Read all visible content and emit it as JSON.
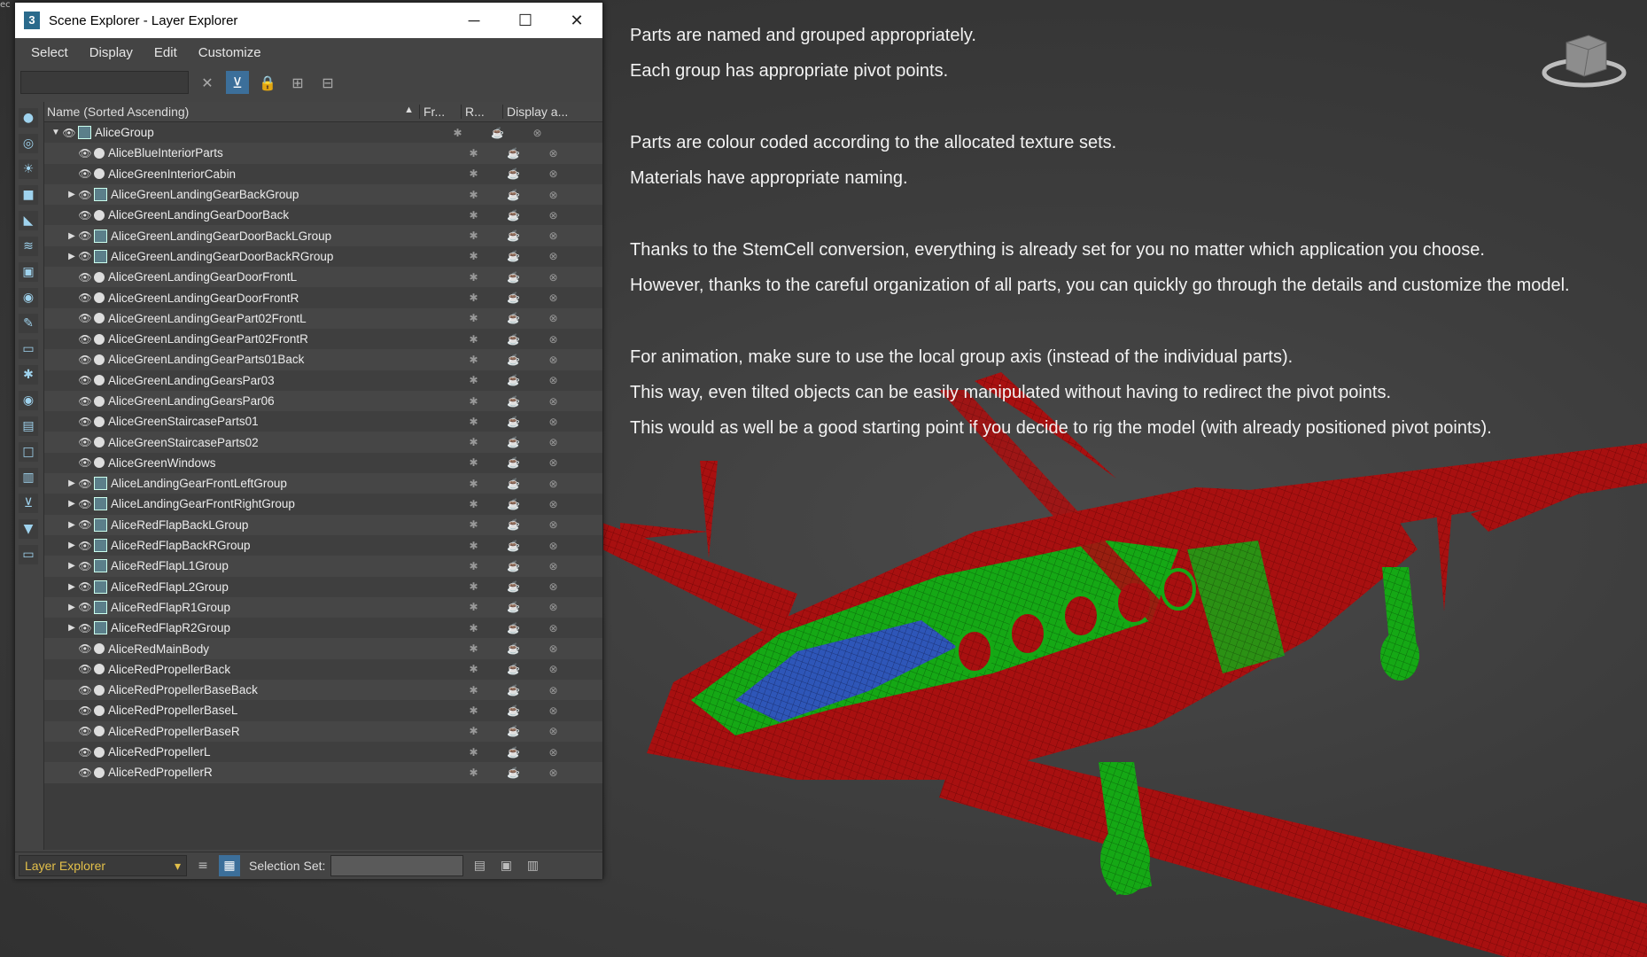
{
  "corner_text": "ec",
  "window": {
    "title": "Scene Explorer - Layer Explorer",
    "app_icon": "3",
    "buttons": {
      "minimize": "─",
      "maximize": "☐",
      "close": "✕"
    }
  },
  "menu": [
    "Select",
    "Display",
    "Edit",
    "Customize"
  ],
  "toolbar": {
    "clear": "✕",
    "filter": "⊻",
    "lock": "🔒",
    "hier1": "⊞",
    "hier2": "⊟"
  },
  "table": {
    "columns": {
      "name": "Name (Sorted Ascending)",
      "sort_arrow": "▲",
      "frozen": "Fr...",
      "render": "R...",
      "display": "Display a..."
    },
    "rows": [
      {
        "label": "AliceGroup",
        "indent": 0,
        "expander": "▼",
        "kind": "group"
      },
      {
        "label": "AliceBlueInteriorParts",
        "indent": 1,
        "expander": "",
        "kind": "object"
      },
      {
        "label": "AliceGreenInteriorCabin",
        "indent": 1,
        "expander": "",
        "kind": "object"
      },
      {
        "label": "AliceGreenLandingGearBackGroup",
        "indent": 1,
        "expander": "▶",
        "kind": "group"
      },
      {
        "label": "AliceGreenLandingGearDoorBack",
        "indent": 1,
        "expander": "",
        "kind": "object"
      },
      {
        "label": "AliceGreenLandingGearDoorBackLGroup",
        "indent": 1,
        "expander": "▶",
        "kind": "group"
      },
      {
        "label": "AliceGreenLandingGearDoorBackRGroup",
        "indent": 1,
        "expander": "▶",
        "kind": "group"
      },
      {
        "label": "AliceGreenLandingGearDoorFrontL",
        "indent": 1,
        "expander": "",
        "kind": "object"
      },
      {
        "label": "AliceGreenLandingGearDoorFrontR",
        "indent": 1,
        "expander": "",
        "kind": "object"
      },
      {
        "label": "AliceGreenLandingGearPart02FrontL",
        "indent": 1,
        "expander": "",
        "kind": "object"
      },
      {
        "label": "AliceGreenLandingGearPart02FrontR",
        "indent": 1,
        "expander": "",
        "kind": "object"
      },
      {
        "label": "AliceGreenLandingGearParts01Back",
        "indent": 1,
        "expander": "",
        "kind": "object"
      },
      {
        "label": "AliceGreenLandingGearsPar03",
        "indent": 1,
        "expander": "",
        "kind": "object"
      },
      {
        "label": "AliceGreenLandingGearsPar06",
        "indent": 1,
        "expander": "",
        "kind": "object"
      },
      {
        "label": "AliceGreenStaircaseParts01",
        "indent": 1,
        "expander": "",
        "kind": "object"
      },
      {
        "label": "AliceGreenStaircaseParts02",
        "indent": 1,
        "expander": "",
        "kind": "object"
      },
      {
        "label": "AliceGreenWindows",
        "indent": 1,
        "expander": "",
        "kind": "object"
      },
      {
        "label": "AliceLandingGearFrontLeftGroup",
        "indent": 1,
        "expander": "▶",
        "kind": "group"
      },
      {
        "label": "AliceLandingGearFrontRightGroup",
        "indent": 1,
        "expander": "▶",
        "kind": "group"
      },
      {
        "label": "AliceRedFlapBackLGroup",
        "indent": 1,
        "expander": "▶",
        "kind": "group"
      },
      {
        "label": "AliceRedFlapBackRGroup",
        "indent": 1,
        "expander": "▶",
        "kind": "group"
      },
      {
        "label": "AliceRedFlapL1Group",
        "indent": 1,
        "expander": "▶",
        "kind": "group"
      },
      {
        "label": "AliceRedFlapL2Group",
        "indent": 1,
        "expander": "▶",
        "kind": "group"
      },
      {
        "label": "AliceRedFlapR1Group",
        "indent": 1,
        "expander": "▶",
        "kind": "group"
      },
      {
        "label": "AliceRedFlapR2Group",
        "indent": 1,
        "expander": "▶",
        "kind": "group"
      },
      {
        "label": "AliceRedMainBody",
        "indent": 1,
        "expander": "",
        "kind": "object"
      },
      {
        "label": "AliceRedPropellerBack",
        "indent": 1,
        "expander": "",
        "kind": "object"
      },
      {
        "label": "AliceRedPropellerBaseBack",
        "indent": 1,
        "expander": "",
        "kind": "object"
      },
      {
        "label": "AliceRedPropellerBaseL",
        "indent": 1,
        "expander": "",
        "kind": "object"
      },
      {
        "label": "AliceRedPropellerBaseR",
        "indent": 1,
        "expander": "",
        "kind": "object"
      },
      {
        "label": "AliceRedPropellerL",
        "indent": 1,
        "expander": "",
        "kind": "object"
      },
      {
        "label": "AliceRedPropellerR",
        "indent": 1,
        "expander": "",
        "kind": "object"
      }
    ]
  },
  "status": {
    "explorer": "Layer Explorer",
    "dropdown_arrow": "▾",
    "selection_set_label": "Selection Set:"
  },
  "notes": [
    "Parts are named and grouped appropriately.",
    "Each group has appropriate pivot points.",
    "",
    "Parts are colour coded according to the allocated texture sets.",
    "Materials have appropriate naming.",
    "",
    "Thanks to the StemCell conversion, everything is already set for you no matter which application you choose.",
    "However, thanks to the careful organization of all parts, you can quickly go through the details and customize the model.",
    "",
    "For animation, make sure to use the local group axis (instead of the individual parts).",
    "This way, even tilted objects can be easily manipulated without having to redirect the pivot points.",
    "This would as well be a good starting point if you decide to rig the model (with already positioned pivot points)."
  ],
  "colors": {
    "wire_red": "#a81010",
    "wire_green": "#12a012",
    "wire_blue": "#2e56b8",
    "selected": "#3c6f9a",
    "explorer_label": "#e3c04a"
  }
}
